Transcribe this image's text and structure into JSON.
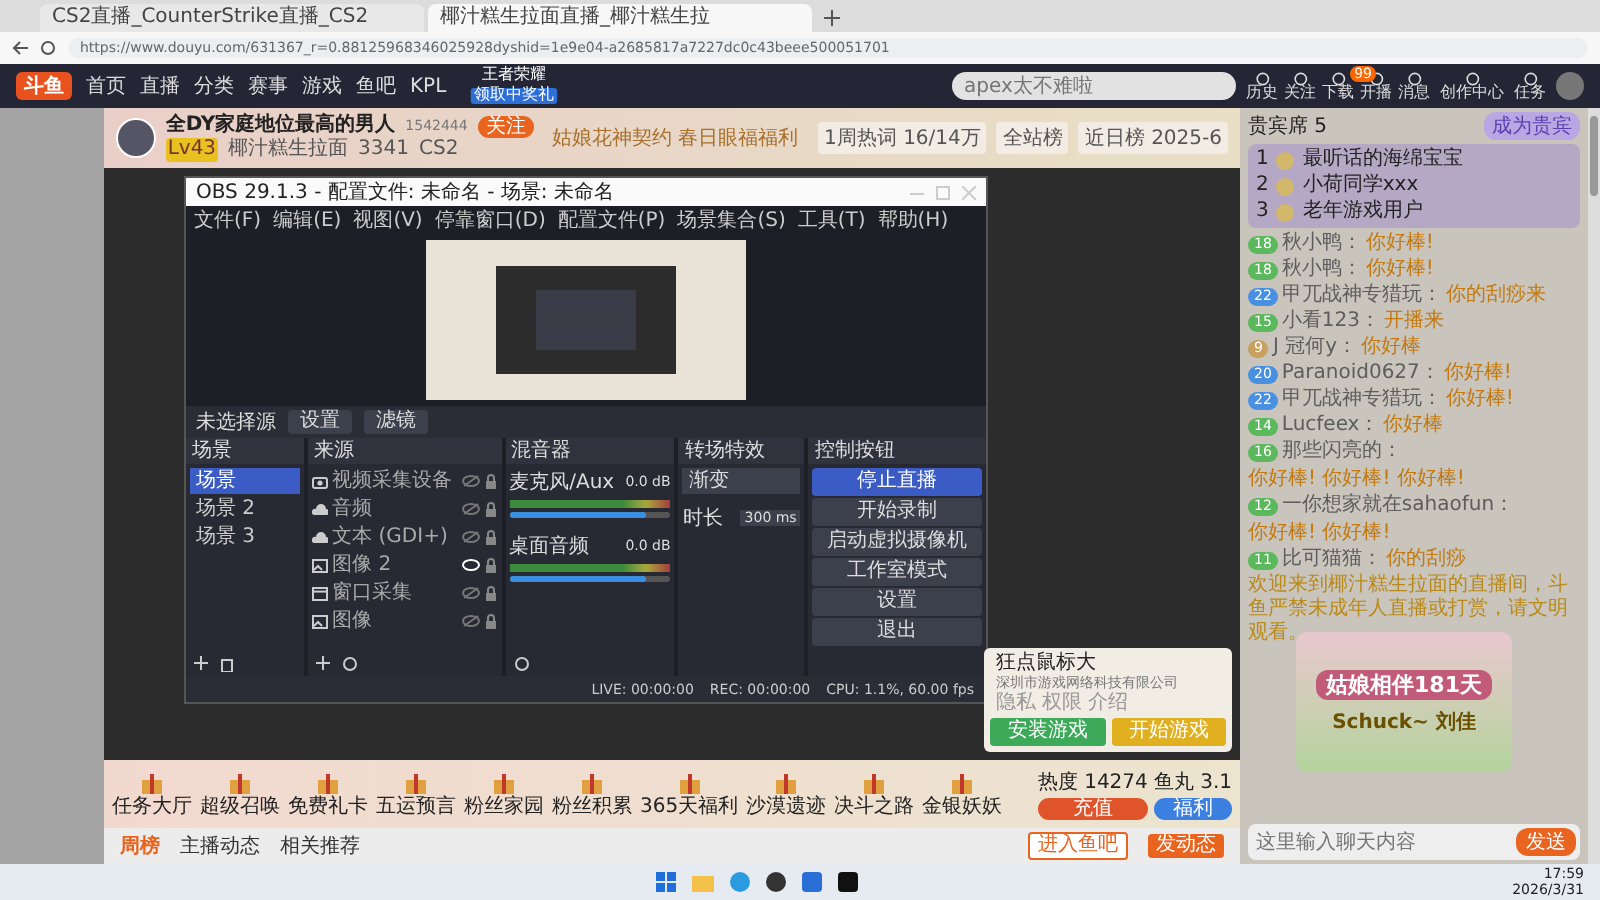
{
  "browser": {
    "tabs": [
      {
        "title": "CS2直播_CounterStrike直播_CS2",
        "selected": false
      },
      {
        "title": "椰汁糕生拉面直播_椰汁糕生拉",
        "selected": true
      }
    ],
    "url": "https://www.douyu.com/631367_r=0.88125968346025928dyshid=1e9e04-a2685817a7227dc0c43beee500051701"
  },
  "site_nav": {
    "logo": "斗鱼",
    "links": [
      "首页",
      "直播",
      "分类",
      "赛事",
      "游戏",
      "鱼吧",
      "KPL"
    ],
    "promo": {
      "title": "王者荣耀",
      "badge": "领取中奖礼"
    },
    "search": {
      "placeholder": "apex太不难啦"
    },
    "actions": [
      "历史",
      "关注",
      "下载",
      "开播",
      "消息",
      "创作中心",
      "任务"
    ],
    "message_count": "99"
  },
  "room": {
    "title": "全DY家庭地位最高的男人",
    "room_id": "1542444",
    "follow": "关注",
    "level": "Lv43",
    "streamer": "椰汁糕生拉面",
    "heat": "3341",
    "category": "CS2",
    "banner": "姑娘花神契约 春日眼福福利",
    "stats": [
      "1周热词 16/14万",
      "全站榜",
      "近日榜 2025-6"
    ]
  },
  "obs": {
    "title": "OBS 29.1.3 - 配置文件: 未命名 - 场景: 未命名",
    "menu": [
      "文件(F)",
      "编辑(E)",
      "视图(V)",
      "停靠窗口(D)",
      "配置文件(P)",
      "场景集合(S)",
      "工具(T)",
      "帮助(H)"
    ],
    "source_label": "未选择源",
    "source_buttons": [
      "设置",
      "滤镜"
    ],
    "scenes": {
      "title": "场景",
      "items": [
        {
          "name": "场景",
          "selected": true
        },
        {
          "name": "场景 2",
          "selected": false
        },
        {
          "name": "场景 3",
          "selected": false
        }
      ]
    },
    "sources": {
      "title": "来源",
      "items": [
        {
          "name": "视频采集设备",
          "kind": "camera",
          "visible": false
        },
        {
          "name": "音频",
          "kind": "audio",
          "visible": false
        },
        {
          "name": "文本 (GDI+)",
          "kind": "audio",
          "visible": false
        },
        {
          "name": "图像 2",
          "kind": "image",
          "visible": true
        },
        {
          "name": "窗口采集",
          "kind": "window",
          "visible": false
        },
        {
          "name": "图像",
          "kind": "image",
          "visible": false
        }
      ]
    },
    "mixer": {
      "title": "混音器",
      "channels": [
        {
          "name": "麦克风/Aux",
          "reading": "0.0 dB",
          "level": 0.85
        },
        {
          "name": "桌面音频",
          "reading": "0.0 dB",
          "level": 0.85
        }
      ]
    },
    "transitions": {
      "title": "转场特效",
      "effect": "渐变",
      "duration_label": "时长",
      "duration": "300 ms"
    },
    "controls": {
      "title": "控制按钮",
      "buttons": [
        {
          "label": "停止直播",
          "selected": true
        },
        {
          "label": "开始录制",
          "selected": false
        },
        {
          "label": "启动虚拟摄像机",
          "selected": false
        },
        {
          "label": "工作室模式",
          "selected": false
        },
        {
          "label": "设置",
          "selected": false
        },
        {
          "label": "退出",
          "selected": false
        }
      ]
    },
    "status": [
      "LIVE: 00:00:00",
      "REC: 00:00:00",
      "CPU: 1.1%, 60.00 fps"
    ]
  },
  "popup": {
    "title": "狂点鼠标大",
    "company": "深圳市游戏网络科技有限公司",
    "links": [
      "隐私",
      "权限",
      "介绍"
    ],
    "buttons": [
      "安装游戏",
      "开始游戏"
    ]
  },
  "gift_bar": {
    "items": [
      "任务大厅",
      "超级召唤",
      "免费礼卡",
      "五运预言",
      "粉丝家园",
      "粉丝积累",
      "365天福利",
      "沙漠遗迹",
      "决斗之路",
      "金银妖妖"
    ],
    "heat": "热度 14274",
    "fish": "鱼丸 3.1",
    "buttons": [
      "充值",
      "福利"
    ]
  },
  "room_tabs": {
    "tabs": [
      {
        "label": "周榜",
        "selected": true
      },
      {
        "label": "主播动态",
        "selected": false
      },
      {
        "label": "相关推荐",
        "selected": false
      }
    ],
    "buttons": [
      "进入鱼吧",
      "发动态"
    ]
  },
  "chat": {
    "vip_label": "贵宾席 5",
    "vip_button": "成为贵宾",
    "ranks": [
      {
        "rank": "1",
        "name": "最听话的海绵宝宝"
      },
      {
        "rank": "2",
        "name": "小荷同学xxx"
      },
      {
        "rank": "3",
        "name": "老年游戏用户"
      }
    ],
    "messages": [
      {
        "badge": "18",
        "color": "#5cb85c",
        "name": "秋小鸭：",
        "text": "你好棒!"
      },
      {
        "badge": "18",
        "color": "#5cb85c",
        "name": "秋小鸭：",
        "text": "你好棒!"
      },
      {
        "badge": "22",
        "color": "#4a90e2",
        "name": "甲兀战神专猎玩：",
        "text": "你的刮痧来"
      },
      {
        "badge": "15",
        "color": "#5cb85c",
        "name": "小看123：",
        "text": "开播来"
      },
      {
        "badge": "9",
        "color": "#c8a060",
        "name": "J 冠何y：",
        "text": "你好棒"
      },
      {
        "badge": "20",
        "color": "#4a90e2",
        "name": "Paranoid0627：",
        "text": "你好棒!"
      },
      {
        "badge": "22",
        "color": "#4a90e2",
        "name": "甲兀战神专猎玩：",
        "text": "你好棒!"
      },
      {
        "badge": "14",
        "color": "#5cb85c",
        "name": "Lucfeex：",
        "text": "你好棒"
      },
      {
        "badge": "16",
        "color": "#5cb85c",
        "name": "那些闪亮的：",
        "text": "你好棒! 你好棒! 你好棒!"
      },
      {
        "badge": "12",
        "color": "#5cb85c",
        "name": "一你想家就在sahaofun：",
        "text": "你好棒! 你好棒!"
      },
      {
        "badge": "11",
        "color": "#5cb85c",
        "name": "比可猫猫：",
        "text": "你的刮痧"
      }
    ],
    "notice": "欢迎来到椰汁糕生拉面的直播间，斗鱼严禁未成年人直播或打赏，请文明观看。",
    "promo": {
      "title": "姑娘相伴181天",
      "user": "Schuck~ 刘佳"
    },
    "input": {
      "placeholder": "这里输入聊天内容",
      "send": "发送"
    }
  },
  "taskbar": {
    "time": "17:59",
    "date": "2026/3/31"
  }
}
